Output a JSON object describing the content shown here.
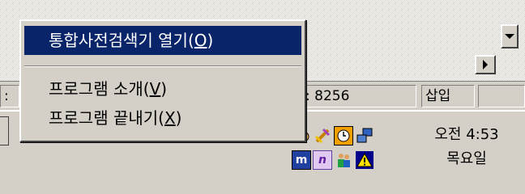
{
  "context_menu": {
    "items": [
      {
        "label_prefix": "통합사전검색기 열기(",
        "mnemonic": "O",
        "label_suffix": ")",
        "selected": true
      },
      {
        "label_prefix": "프로그램 소개(",
        "mnemonic": "V",
        "label_suffix": ")",
        "selected": false
      },
      {
        "label_prefix": "프로그램 끝내기(",
        "mnemonic": "X",
        "label_suffix": ")",
        "selected": false
      }
    ]
  },
  "statusbar": {
    "left_fragment": ":",
    "position_text": ": 8256",
    "mode_text": "삽입"
  },
  "tray": {
    "icons": [
      "paint-palette-icon",
      "satellite-icon",
      "clock-icon",
      "network-computers-icon",
      "m-app-icon",
      "n-app-icon",
      "users-icon",
      "warning-icon"
    ],
    "clock_time": "오전 4:53",
    "clock_day": "목요일"
  },
  "colors": {
    "menu_highlight": "#0a246a",
    "face": "#d4d0c8"
  }
}
